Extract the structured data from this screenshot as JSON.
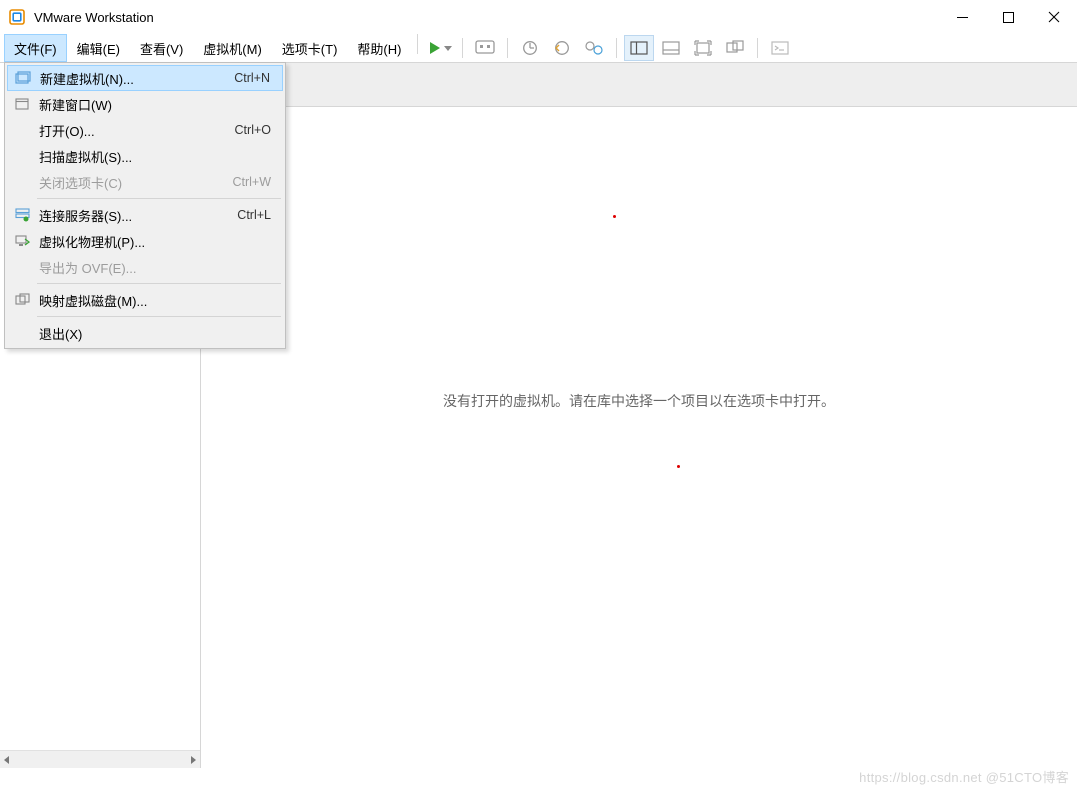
{
  "title": "VMware Workstation",
  "menubar": {
    "file": "文件(F)",
    "edit": "编辑(E)",
    "view": "查看(V)",
    "vm": "虚拟机(M)",
    "tabs": "选项卡(T)",
    "help": "帮助(H)"
  },
  "file_menu": {
    "new_vm": {
      "label": "新建虚拟机(N)...",
      "shortcut": "Ctrl+N"
    },
    "new_window": {
      "label": "新建窗口(W)",
      "shortcut": ""
    },
    "open": {
      "label": "打开(O)...",
      "shortcut": "Ctrl+O"
    },
    "scan_vm": {
      "label": "扫描虚拟机(S)...",
      "shortcut": ""
    },
    "close_tab": {
      "label": "关闭选项卡(C)",
      "shortcut": "Ctrl+W"
    },
    "connect_server": {
      "label": "连接服务器(S)...",
      "shortcut": "Ctrl+L"
    },
    "virtualize_physical": {
      "label": "虚拟化物理机(P)...",
      "shortcut": ""
    },
    "export_ovf": {
      "label": "导出为 OVF(E)...",
      "shortcut": ""
    },
    "map_vdisk": {
      "label": "映射虚拟磁盘(M)...",
      "shortcut": ""
    },
    "exit": {
      "label": "退出(X)",
      "shortcut": ""
    }
  },
  "main": {
    "empty_message": "没有打开的虚拟机。请在库中选择一个项目以在选项卡中打开。"
  },
  "watermark": "https://blog.csdn.net @51CTO博客"
}
